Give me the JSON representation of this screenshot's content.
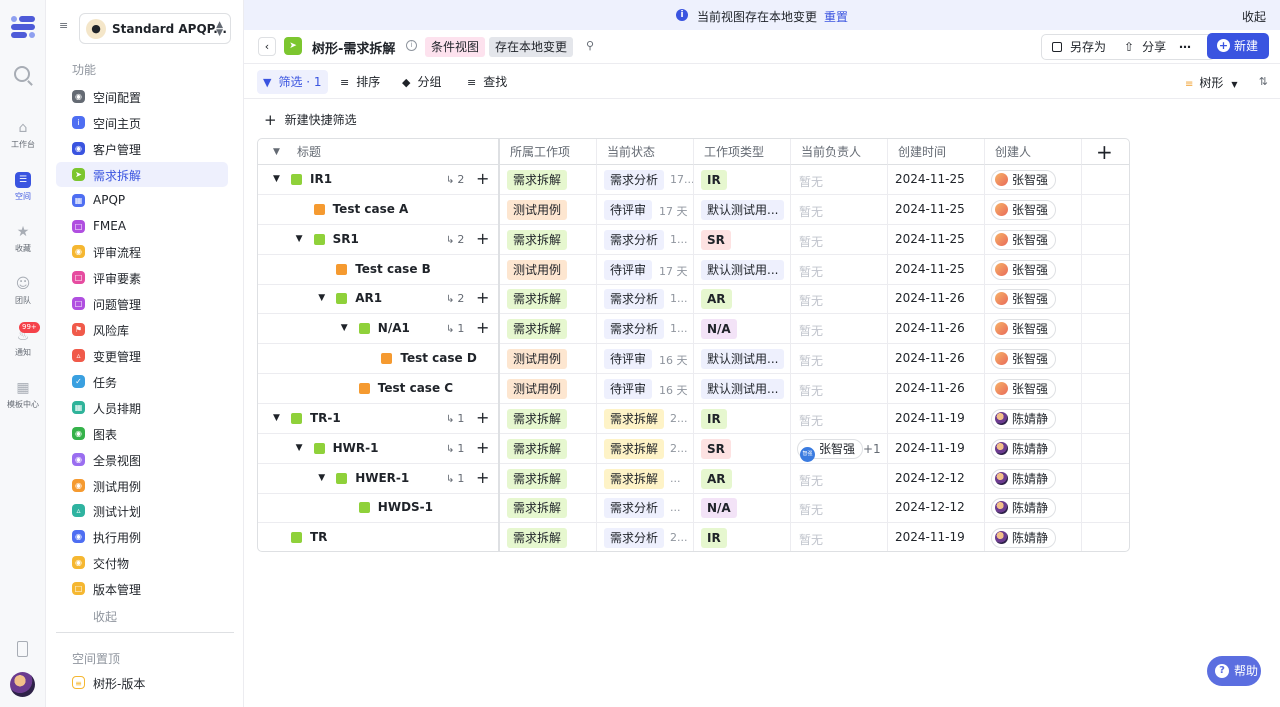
{
  "rail": {
    "items": [
      {
        "label": "工作台",
        "icon": "home-icon"
      },
      {
        "label": "空间",
        "icon": "space-icon"
      },
      {
        "label": "收藏",
        "icon": "star-icon"
      },
      {
        "label": "团队",
        "icon": "team-icon"
      },
      {
        "label": "通知",
        "icon": "bell-icon",
        "badge": "99+"
      },
      {
        "label": "模板中心",
        "icon": "template-icon"
      }
    ]
  },
  "sidebar": {
    "space_name": "Standard APQP...",
    "section_title": "功能",
    "items": [
      {
        "label": "空间配置",
        "color": "#646a73"
      },
      {
        "label": "空间主页",
        "color": "#4e6ef2"
      },
      {
        "label": "客户管理",
        "color": "#3a54e0"
      },
      {
        "label": "需求拆解",
        "color": "#7cc62f"
      },
      {
        "label": "APQP",
        "color": "#4e6ef2"
      },
      {
        "label": "FMEA",
        "color": "#b04fe0"
      },
      {
        "label": "评审流程",
        "color": "#f5b731"
      },
      {
        "label": "评审要素",
        "color": "#e64ca0"
      },
      {
        "label": "问题管理",
        "color": "#b04fe0"
      },
      {
        "label": "风险库",
        "color": "#f05a4a"
      },
      {
        "label": "变更管理",
        "color": "#f05a4a"
      },
      {
        "label": "任务",
        "color": "#3aa0e0"
      },
      {
        "label": "人员排期",
        "color": "#2fb39a"
      },
      {
        "label": "图表",
        "color": "#35b24a"
      },
      {
        "label": "全景视图",
        "color": "#9a6ef0"
      },
      {
        "label": "测试用例",
        "color": "#f59a30"
      },
      {
        "label": "测试计划",
        "color": "#2fb3a0"
      },
      {
        "label": "执行用例",
        "color": "#4e6ef2"
      },
      {
        "label": "交付物",
        "color": "#f5b731"
      },
      {
        "label": "版本管理",
        "color": "#f5b731"
      }
    ],
    "collapse_label": "收起",
    "pinned_title": "空间置顶",
    "pinned_items": [
      {
        "label": "树形-版本"
      }
    ]
  },
  "banner": {
    "text": "当前视图存在本地变更",
    "reset": "重置",
    "close": "收起"
  },
  "titlebar": {
    "title": "树形-需求拆解",
    "tag_condition": "条件视图",
    "tag_local": "存在本地变更",
    "save_as": "另存为",
    "share": "分享",
    "new_label": "新建"
  },
  "toolbar": {
    "filter": "筛选 · 1",
    "sort": "排序",
    "group": "分组",
    "find": "查找",
    "view_mode": "树形"
  },
  "quick_filter": "新建快捷筛选",
  "table": {
    "headers": [
      "标题",
      "所属工作项",
      "当前状态",
      "工作项类型",
      "当前负责人",
      "创建时间",
      "创建人"
    ],
    "rows": [
      {
        "title": "IR1",
        "level": 0,
        "expand": true,
        "color": "#8fd13a",
        "child_count": "2",
        "belongs": "需求拆解",
        "status": "需求分析",
        "status_dur": "17...",
        "type": "IR",
        "assignee": "暂无",
        "created": "2024-11-25",
        "creator": "张智强"
      },
      {
        "title": "Test case A",
        "level": 1,
        "expand": false,
        "color": "#f59a30",
        "child_count": "",
        "belongs": "测试用例",
        "status": "待评审",
        "status_dur": "17 天",
        "type": "默认测试用...",
        "assignee": "暂无",
        "created": "2024-11-25",
        "creator": "张智强"
      },
      {
        "title": "SR1",
        "level": 1,
        "expand": true,
        "color": "#8fd13a",
        "child_count": "2",
        "belongs": "需求拆解",
        "status": "需求分析",
        "status_dur": "1...",
        "type": "SR",
        "assignee": "暂无",
        "created": "2024-11-25",
        "creator": "张智强"
      },
      {
        "title": "Test case B",
        "level": 2,
        "expand": false,
        "color": "#f59a30",
        "child_count": "",
        "belongs": "测试用例",
        "status": "待评审",
        "status_dur": "17 天",
        "type": "默认测试用...",
        "assignee": "暂无",
        "created": "2024-11-25",
        "creator": "张智强"
      },
      {
        "title": "AR1",
        "level": 2,
        "expand": true,
        "color": "#8fd13a",
        "child_count": "2",
        "belongs": "需求拆解",
        "status": "需求分析",
        "status_dur": "1...",
        "type": "AR",
        "assignee": "暂无",
        "created": "2024-11-26",
        "creator": "张智强"
      },
      {
        "title": "N/A1",
        "level": 3,
        "expand": true,
        "color": "#8fd13a",
        "child_count": "1",
        "belongs": "需求拆解",
        "status": "需求分析",
        "status_dur": "1...",
        "type": "N/A",
        "assignee": "暂无",
        "created": "2024-11-26",
        "creator": "张智强"
      },
      {
        "title": "Test case D",
        "level": 4,
        "expand": false,
        "color": "#f59a30",
        "child_count": "",
        "belongs": "测试用例",
        "status": "待评审",
        "status_dur": "16 天",
        "type": "默认测试用...",
        "assignee": "暂无",
        "created": "2024-11-26",
        "creator": "张智强"
      },
      {
        "title": "Test case C",
        "level": 3,
        "expand": false,
        "color": "#f59a30",
        "child_count": "",
        "belongs": "测试用例",
        "status": "待评审",
        "status_dur": "16 天",
        "type": "默认测试用...",
        "assignee": "暂无",
        "created": "2024-11-26",
        "creator": "张智强"
      },
      {
        "title": "TR-1",
        "level": 0,
        "expand": true,
        "color": "#8fd13a",
        "child_count": "1",
        "belongs": "需求拆解",
        "status": "需求拆解",
        "status_dur": "2...",
        "type": "IR",
        "assignee": "暂无",
        "created": "2024-11-19",
        "creator": "陈婧静"
      },
      {
        "title": "HWR-1",
        "level": 1,
        "expand": true,
        "color": "#8fd13a",
        "child_count": "1",
        "belongs": "需求拆解",
        "status": "需求拆解",
        "status_dur": "2...",
        "type": "SR",
        "assignee": "张智强",
        "assignee_extra": "+1",
        "created": "2024-11-19",
        "creator": "陈婧静"
      },
      {
        "title": "HWER-1",
        "level": 2,
        "expand": true,
        "color": "#8fd13a",
        "child_count": "1",
        "belongs": "需求拆解",
        "status": "需求拆解",
        "status_dur": "...",
        "type": "AR",
        "assignee": "暂无",
        "created": "2024-12-12",
        "creator": "陈婧静"
      },
      {
        "title": "HWDS-1",
        "level": 3,
        "expand": false,
        "color": "#8fd13a",
        "child_count": "",
        "belongs": "需求拆解",
        "status": "需求分析",
        "status_dur": "...",
        "type": "N/A",
        "assignee": "暂无",
        "created": "2024-12-12",
        "creator": "陈婧静"
      },
      {
        "title": "TR",
        "level": 0,
        "expand": false,
        "color": "#8fd13a",
        "child_count": "",
        "belongs": "需求拆解",
        "status": "需求分析",
        "status_dur": "2...",
        "type": "IR",
        "assignee": "暂无",
        "created": "2024-11-19",
        "creator": "陈婧静"
      }
    ],
    "type_colors": {
      "IR": "#e6f7cf",
      "SR": "#fde2e2",
      "AR": "#e6f7cf",
      "N/A": "#f3e3f7",
      "默认测试用...": "#eef0fd"
    },
    "status_classes": {
      "需求分析": "st-ana",
      "待评审": "st-wait",
      "需求拆解": "st-req"
    }
  },
  "help_label": "帮助"
}
